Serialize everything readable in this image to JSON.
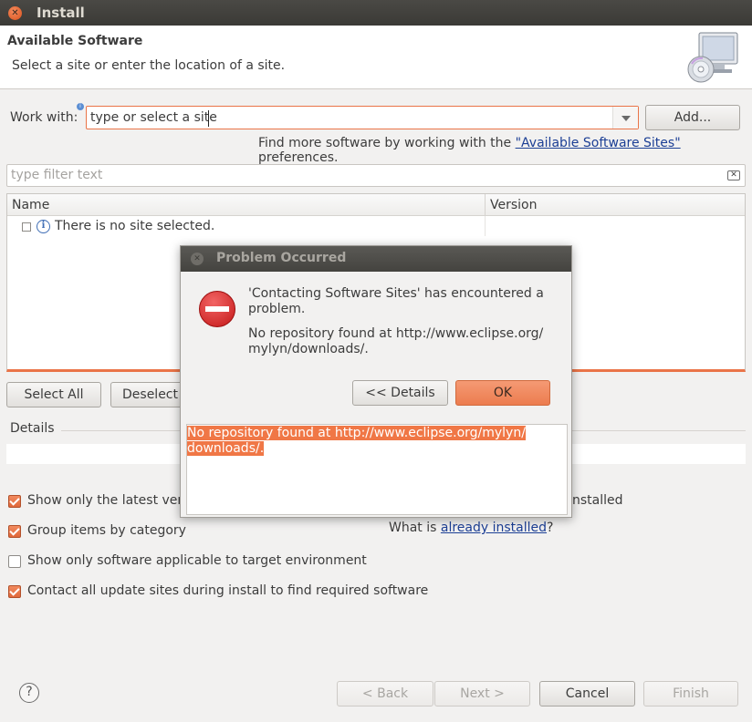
{
  "window": {
    "title": "Install"
  },
  "banner": {
    "heading": "Available Software",
    "subtitle": "Select a site or enter the location of a site."
  },
  "work_with": {
    "label": "Work with:",
    "value": "type or select a site",
    "add_button": "Add...",
    "hint_prefix": "Find more software by working with the ",
    "hint_link": "\"Available Software Sites\"",
    "hint_suffix": " preferences."
  },
  "filter": {
    "placeholder": "type filter text"
  },
  "table": {
    "columns": [
      "Name",
      "Version"
    ],
    "rows": [
      {
        "name": "There is no site selected.",
        "version": ""
      }
    ]
  },
  "selection_buttons": {
    "select_all": "Select All",
    "deselect_all": "Deselect A"
  },
  "details": {
    "legend": "Details"
  },
  "options": [
    {
      "label": "Show only the latest versi",
      "checked": true
    },
    {
      "label": "Group items by category",
      "checked": true
    },
    {
      "label": "Show only software applicable to target environment",
      "checked": false
    },
    {
      "label": "Contact all update sites during install to find required software",
      "checked": true
    }
  ],
  "installed_tail": "nstalled",
  "already_installed": {
    "prefix": "What is ",
    "link": "already installed",
    "suffix": "?"
  },
  "footer": {
    "back": "< Back",
    "next": "Next >",
    "cancel": "Cancel",
    "finish": "Finish"
  },
  "dialog": {
    "title": "Problem Occurred",
    "message_line1": "'Contacting Software Sites' has encountered a",
    "message_line2": "problem.",
    "detail_line1": "No repository found at http://www.eclipse.org/",
    "detail_line2": "mylyn/downloads/.",
    "details_button": "<< Details",
    "ok_button": "OK",
    "details_text_line1": "No repository found at http://www.eclipse.org/mylyn/",
    "details_text_line2": "downloads/."
  },
  "colors": {
    "accent": "#ea7448",
    "link": "#1c3f95",
    "error": "#c41818"
  }
}
